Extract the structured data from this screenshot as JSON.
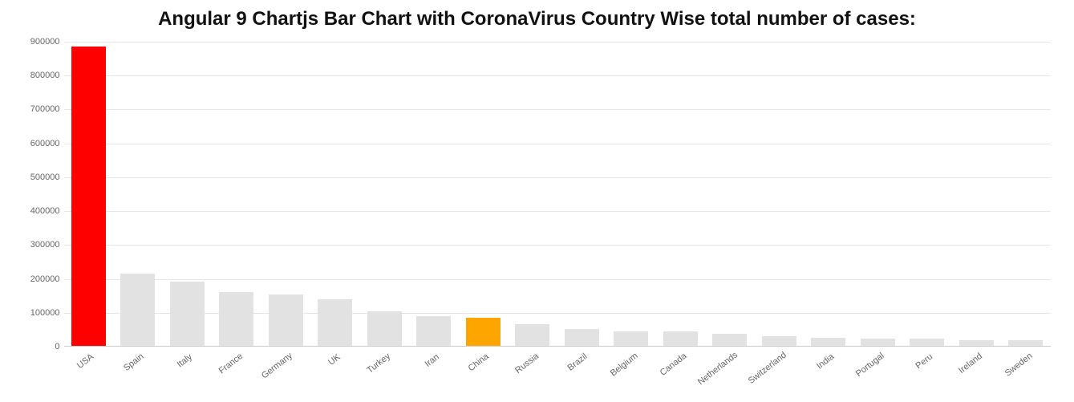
{
  "title": "Angular 9 Chartjs Bar Chart with CoronaVirus Country Wise total number of cases:",
  "chart_data": {
    "type": "bar",
    "title": "Angular 9 Chartjs Bar Chart with CoronaVirus Country Wise total number of cases:",
    "xlabel": "",
    "ylabel": "",
    "ylim": [
      0,
      900000
    ],
    "y_ticks": [
      0,
      100000,
      200000,
      300000,
      400000,
      500000,
      600000,
      700000,
      800000,
      900000
    ],
    "categories": [
      "USA",
      "Spain",
      "Italy",
      "France",
      "Germany",
      "UK",
      "Turkey",
      "Iran",
      "China",
      "Russia",
      "Brazil",
      "Belgium",
      "Canada",
      "Netherlands",
      "Switzerland",
      "India",
      "Portugal",
      "Peru",
      "Ireland",
      "Sweden"
    ],
    "values": [
      886000,
      213000,
      190000,
      160000,
      153000,
      138000,
      101000,
      88000,
      84000,
      63000,
      50000,
      43000,
      42000,
      36000,
      29000,
      23000,
      22000,
      21000,
      17000,
      17000
    ],
    "colors": {
      "default": "#e2e2e2",
      "highlight1_index": 0,
      "highlight1_color": "#ff0000",
      "highlight2_index": 8,
      "highlight2_color": "#ffa500"
    }
  }
}
